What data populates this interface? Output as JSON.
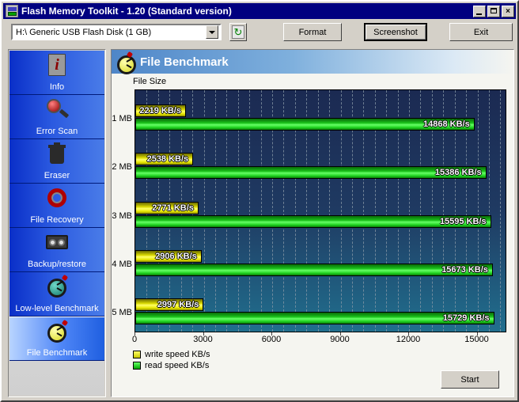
{
  "window": {
    "title": "Flash Memory Toolkit - 1.20 (Standard version)",
    "app_icon": "flash-drive-icon",
    "minimize_label": "_",
    "maximize_label": "□",
    "close_label": "×"
  },
  "toolbar": {
    "drive_value": "H:\\ Generic USB Flash Disk (1 GB)",
    "refresh_icon": "↻",
    "format_label": "Format",
    "screenshot_label": "Screenshot",
    "exit_label": "Exit"
  },
  "sidebar": {
    "items": [
      {
        "label": "Info",
        "icon": "info-document-icon",
        "selected": false
      },
      {
        "label": "Error Scan",
        "icon": "magnifier-icon",
        "selected": false
      },
      {
        "label": "Eraser",
        "icon": "trash-bin-icon",
        "selected": false
      },
      {
        "label": "File Recovery",
        "icon": "life-ring-icon",
        "selected": false
      },
      {
        "label": "Backup/restore",
        "icon": "tape-cassette-icon",
        "selected": false
      },
      {
        "label": "Low-level Benchmark",
        "icon": "stopwatch-teal-icon",
        "selected": false
      },
      {
        "label": "File Benchmark",
        "icon": "stopwatch-yellow-icon",
        "selected": true
      }
    ]
  },
  "main": {
    "header_title": "File Benchmark",
    "header_icon": "stopwatch-yellow-icon",
    "axis_title": "File Size",
    "start_label": "Start"
  },
  "chart_data": {
    "type": "bar",
    "orientation": "horizontal",
    "title": "File Benchmark",
    "xlabel": "",
    "ylabel": "File Size",
    "categories": [
      "1 MB",
      "2 MB",
      "3 MB",
      "4 MB",
      "5 MB"
    ],
    "series": [
      {
        "name": "write speed KB/s",
        "color": "#ffff00",
        "values": [
          2219,
          2538,
          2771,
          2906,
          2997
        ],
        "labels": [
          "2219 KB/s",
          "2538 KB/s",
          "2771 KB/s",
          "2906 KB/s",
          "2997 KB/s"
        ]
      },
      {
        "name": "read speed KB/s",
        "color": "#00d000",
        "values": [
          14868,
          15386,
          15595,
          15673,
          15729
        ],
        "labels": [
          "14868 KB/s",
          "15386 KB/s",
          "15595 KB/s",
          "15673 KB/s",
          "15729 KB/s"
        ]
      }
    ],
    "xticks": [
      0,
      3000,
      6000,
      9000,
      12000,
      15000
    ],
    "xtick_labels": [
      "0",
      "3000",
      "6000",
      "9000",
      "12000",
      "15000"
    ],
    "xlim": [
      0,
      16300
    ],
    "grid": "vertical-dashed",
    "legend_position": "below-left",
    "legend": [
      "write speed KB/s",
      "read speed KB/s"
    ],
    "plot_background": "#1e3a60"
  }
}
